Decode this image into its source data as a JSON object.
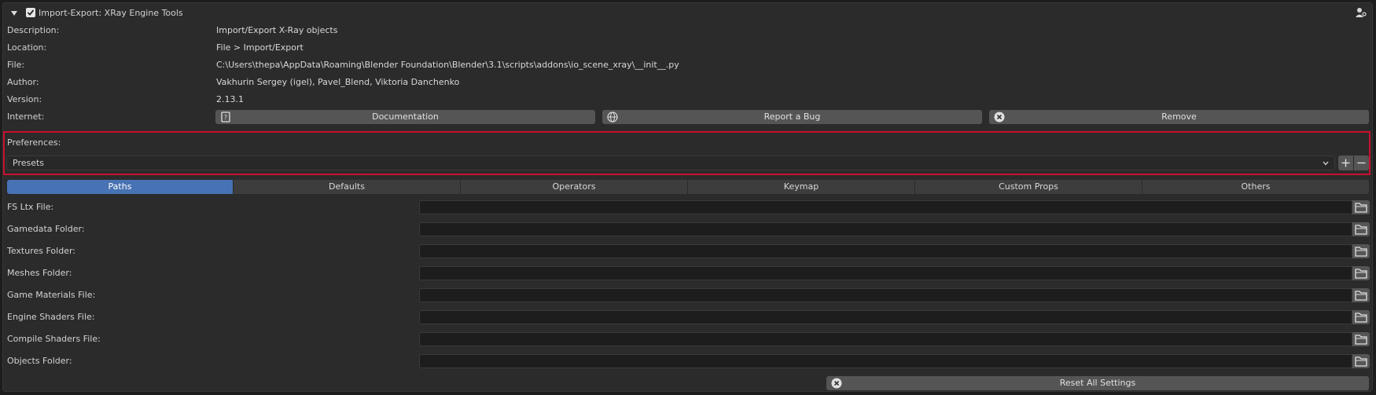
{
  "header": {
    "title": "Import-Export: XRay Engine Tools",
    "enabled": true
  },
  "info": {
    "description_label": "Description:",
    "description_value": "Import/Export X-Ray objects",
    "location_label": "Location:",
    "location_value": "File > Import/Export",
    "file_label": "File:",
    "file_value": "C:\\Users\\thepa\\AppData\\Roaming\\Blender Foundation\\Blender\\3.1\\scripts\\addons\\io_scene_xray\\__init__.py",
    "author_label": "Author:",
    "author_value": "Vakhurin Sergey (igel), Pavel_Blend, Viktoria Danchenko",
    "version_label": "Version:",
    "version_value": "2.13.1",
    "internet_label": "Internet:"
  },
  "buttons": {
    "documentation": "Documentation",
    "report_bug": "Report a Bug",
    "remove": "Remove",
    "reset_all": "Reset All Settings"
  },
  "preferences": {
    "label": "Preferences:",
    "presets_value": "Presets",
    "highlight_color": "#c8102e"
  },
  "tabs": [
    {
      "label": "Paths",
      "active": true
    },
    {
      "label": "Defaults",
      "active": false
    },
    {
      "label": "Operators",
      "active": false
    },
    {
      "label": "Keymap",
      "active": false
    },
    {
      "label": "Custom Props",
      "active": false
    },
    {
      "label": "Others",
      "active": false
    }
  ],
  "paths": [
    {
      "label": "FS Ltx File:",
      "value": ""
    },
    {
      "label": "Gamedata Folder:",
      "value": ""
    },
    {
      "label": "Textures Folder:",
      "value": ""
    },
    {
      "label": "Meshes Folder:",
      "value": ""
    },
    {
      "label": "Game Materials File:",
      "value": ""
    },
    {
      "label": "Engine Shaders File:",
      "value": ""
    },
    {
      "label": "Compile Shaders File:",
      "value": ""
    },
    {
      "label": "Objects Folder:",
      "value": ""
    }
  ],
  "colors": {
    "accent": "#4772b3",
    "button": "#555555",
    "panel": "#2b2b2b"
  }
}
